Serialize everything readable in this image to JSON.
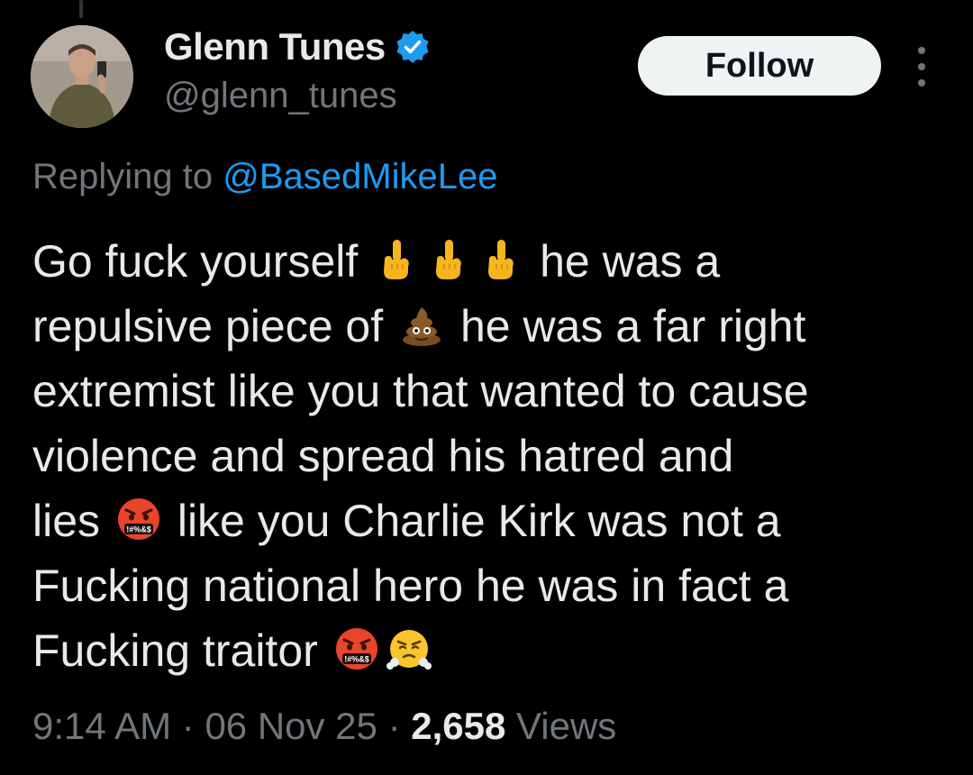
{
  "author": {
    "display_name": "Glenn Tunes",
    "handle": "@glenn_tunes",
    "verified": true,
    "verified_color": "#1d9bf0"
  },
  "follow_label": "Follow",
  "reply": {
    "prefix": "Replying to ",
    "mention": "@BasedMikeLee"
  },
  "tweet": {
    "line1_a": "Go fuck yourself",
    "line1_b": "he was a",
    "line2_a": "repulsive piece of",
    "line2_b": "he was a far right",
    "line3": "extremist like you that wanted to cause",
    "line4": "violence and spread his hatred and",
    "line5_a": "lies",
    "line5_b": "like you Charlie Kirk was not a",
    "line6": "Fucking national hero he was in fact a",
    "line7_a": "Fucking traitor",
    "emojis": [
      "middle-finger",
      "middle-finger",
      "middle-finger",
      "pile-of-poo",
      "face-with-symbols-on-mouth",
      "face-with-symbols-on-mouth",
      "face-with-steam-from-nose"
    ]
  },
  "meta": {
    "time": "9:14 AM",
    "sep1": " · ",
    "date": "06 Nov 25",
    "sep2": " · ",
    "views_count": "2,658",
    "views_label": " Views"
  },
  "colors": {
    "background": "#000000",
    "text": "#e7e9ea",
    "secondary": "#71767b",
    "link": "#1d9bf0"
  }
}
